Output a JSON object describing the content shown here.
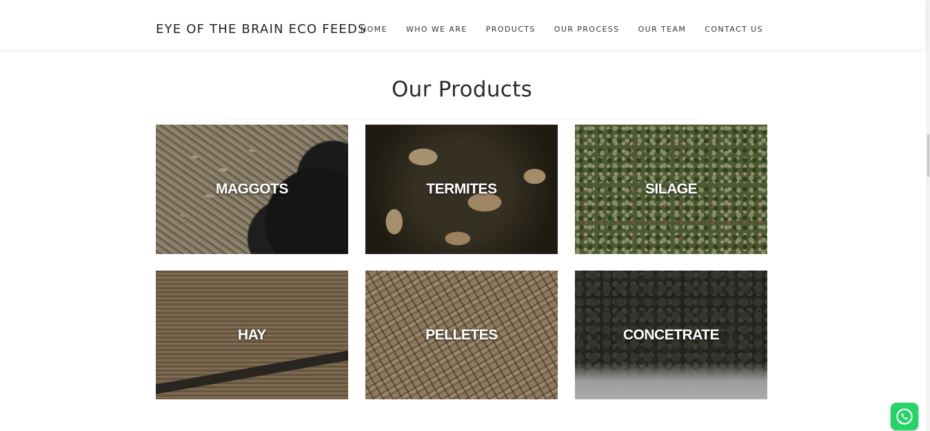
{
  "header": {
    "brand": "EYE OF THE BRAIN ECO FEEDS",
    "nav": [
      "HOME",
      "WHO WE ARE",
      "PRODUCTS",
      "OUR PROCESS",
      "OUR TEAM",
      "CONTACT US"
    ]
  },
  "main": {
    "title": "Our Products",
    "products": [
      {
        "label": "MAGGOTS",
        "image": "maggots-photo"
      },
      {
        "label": "TERMITES",
        "image": "termites-photo"
      },
      {
        "label": "SILAGE",
        "image": "silage-photo"
      },
      {
        "label": "HAY",
        "image": "hay-photo"
      },
      {
        "label": "PELLETES",
        "image": "pellets-photo"
      },
      {
        "label": "CONCETRATE",
        "image": "concentrate-photo"
      }
    ]
  },
  "floating": {
    "whatsapp_icon": "whatsapp-icon",
    "whatsapp_color": "#25d366"
  }
}
